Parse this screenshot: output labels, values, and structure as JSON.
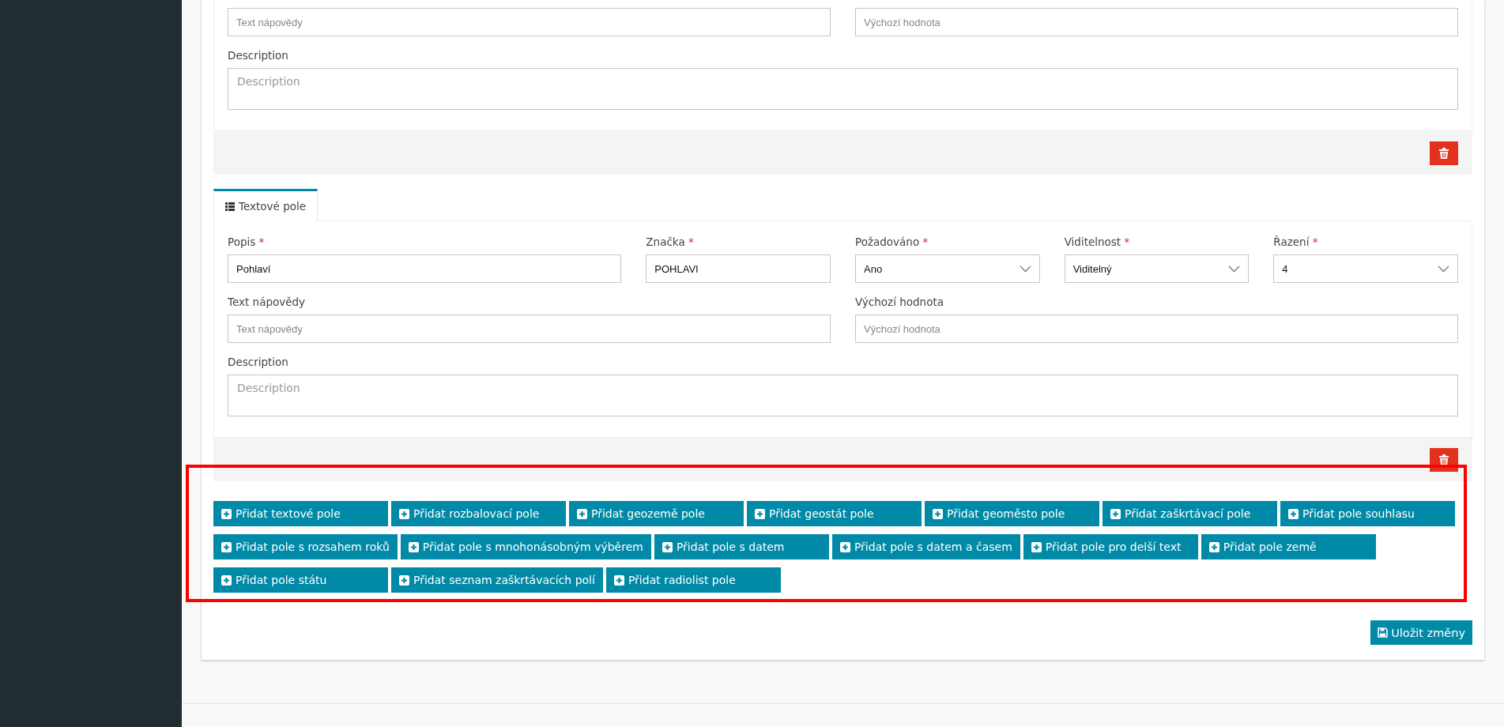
{
  "field_blocks": [
    {
      "rows": [
        {
          "fields": [
            {
              "kind": "text",
              "placeholder": "Text nápovědy"
            },
            {
              "kind": "text",
              "placeholder": "Výchozí hodnota"
            }
          ]
        },
        {
          "fields": [
            {
              "kind": "textarea",
              "label": "Description",
              "placeholder": "Description"
            }
          ]
        }
      ]
    },
    {
      "tab": {
        "label": "Textové pole",
        "selected": true
      },
      "rows": [
        {
          "fields": [
            {
              "kind": "text",
              "label": "Popis",
              "required_mark": "*",
              "value": "Pohlaví"
            },
            {
              "kind": "text",
              "label": "Značka",
              "required_mark": "*",
              "value": "POHLAVI"
            },
            {
              "kind": "select",
              "label": "Požadováno",
              "required_mark": "*",
              "value": "Ano"
            },
            {
              "kind": "select",
              "label": "Viditelnost",
              "required_mark": "*",
              "value": "Viditelný"
            },
            {
              "kind": "select",
              "label": "Řazení",
              "required_mark": "*",
              "value": "4"
            }
          ]
        },
        {
          "fields": [
            {
              "kind": "text",
              "label": "Text nápovědy",
              "placeholder": "Text nápovědy"
            },
            {
              "kind": "text",
              "label": "Výchozí hodnota",
              "placeholder": "Výchozí hodnota"
            }
          ]
        },
        {
          "fields": [
            {
              "kind": "textarea",
              "label": "Description",
              "placeholder": "Description"
            }
          ]
        }
      ]
    }
  ],
  "add_buttons": [
    [
      "Přidat textové pole",
      "Přidat rozbalovací pole",
      "Přidat geozemě pole",
      "Přidat geostát pole",
      "Přidat geoměsto pole",
      "Přidat zaškrtávací pole",
      "Přidat pole souhlasu"
    ],
    [
      "Přidat pole s rozsahem roků",
      "Přidat pole s mnohonásobným výběrem",
      "Přidat pole s datem",
      "Přidat pole s datem a časem",
      "Přidat pole pro delší text",
      "Přidat pole země"
    ],
    [
      "Přidat pole státu",
      "Přidat seznam zaškrtávacích polí",
      "Přidat radiolist pole"
    ]
  ],
  "save_button": "Uložit změny"
}
